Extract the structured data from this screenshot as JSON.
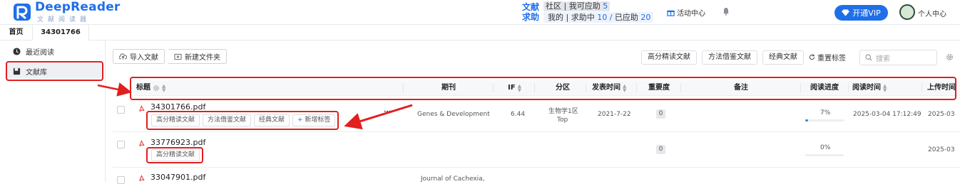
{
  "app": {
    "logo_title": "DeepReader",
    "logo_sub": "文献阅读器",
    "brand_color": "#1f6fe8"
  },
  "header": {
    "wenxian_qiuzhu": "文献\n求助",
    "community": "社区",
    "can_respond": "我可应助",
    "can_respond_count": "5",
    "mine": "我的",
    "requesting": "求助中",
    "requesting_count": "10",
    "slash": "/",
    "responded": "已应助",
    "responded_count": "20",
    "activity": "活动中心",
    "vip": "开通VIP",
    "user_center": "个人中心"
  },
  "tabs": {
    "home": "首页",
    "doc": "34301766"
  },
  "sidebar": {
    "items": [
      {
        "label": "最近阅读",
        "icon": "clock-icon"
      },
      {
        "label": "文献库",
        "icon": "book-icon"
      }
    ]
  },
  "toolbar": {
    "import": "导入文献",
    "new_folder": "新建文件夹",
    "tags": [
      "高分精读文献",
      "方法借鉴文献",
      "经典文献"
    ],
    "reset": "重置标签",
    "search_placeholder": "搜索"
  },
  "table": {
    "headers": {
      "title": "标题",
      "journal": "期刊",
      "if": "IF",
      "zone": "分区",
      "pub_time": "发表时间",
      "importance": "重要度",
      "notes": "备注",
      "progress": "阅读进度",
      "read_time": "阅读时间",
      "upload_time": "上传时间"
    },
    "rows": [
      {
        "filename": "34301766.pdf",
        "tags": [
          "高分精读文献",
          "方法借鉴文献",
          "经典文献"
        ],
        "add_tag": "新增标签",
        "journal": "Genes & Development",
        "if": "6.44",
        "zone_line1": "生物学1区",
        "zone_line2": "Top",
        "pub_time": "2021-7-22",
        "importance": "0",
        "progress_label": "7%",
        "progress_value": 0.07,
        "read_time": "2025-03-04 17:12:49",
        "upload_time": "2025-03"
      },
      {
        "filename": "33776923.pdf",
        "tags": [
          "高分精读文献"
        ],
        "importance": "0",
        "progress_label": "0%",
        "progress_value": 0,
        "upload_time": "2025-03"
      },
      {
        "filename": "33047901.pdf",
        "journal": "Journal of Cachexia,"
      }
    ]
  }
}
